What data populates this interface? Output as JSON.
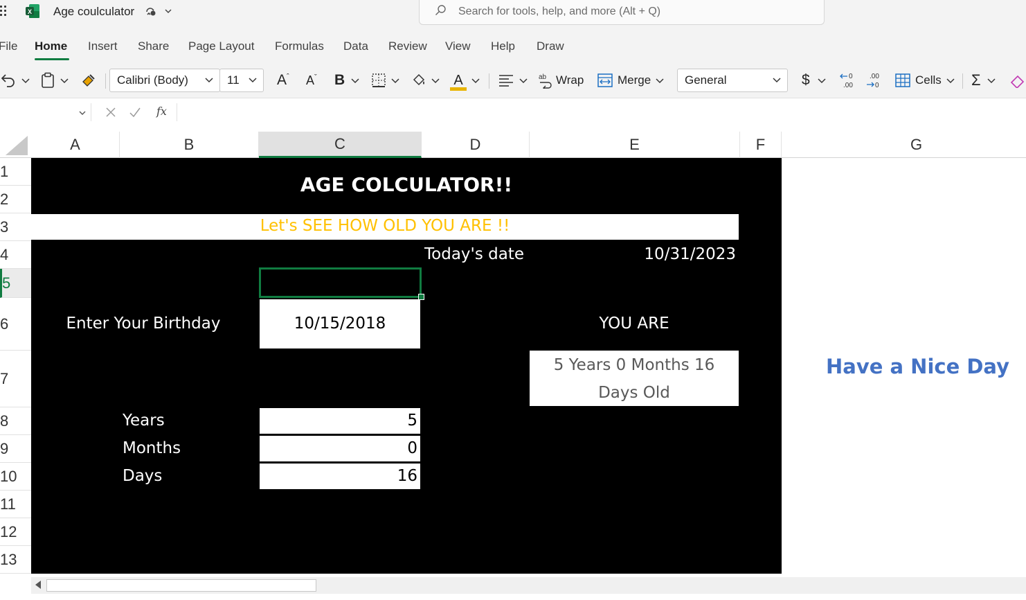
{
  "titlebar": {
    "doc_title": "Age coulculator",
    "search_placeholder": "Search for tools, help, and more (Alt + Q)"
  },
  "tabs": [
    {
      "label": "File"
    },
    {
      "label": "Home",
      "active": true
    },
    {
      "label": "Insert"
    },
    {
      "label": "Share"
    },
    {
      "label": "Page Layout"
    },
    {
      "label": "Formulas"
    },
    {
      "label": "Data"
    },
    {
      "label": "Review"
    },
    {
      "label": "View"
    },
    {
      "label": "Help"
    },
    {
      "label": "Draw"
    }
  ],
  "toolbar": {
    "font_name": "Calibri (Body)",
    "font_size": "11",
    "wrap_label": "Wrap",
    "merge_label": "Merge",
    "number_format": "General",
    "currency_symbol": "$",
    "cells_label": "Cells",
    "font_color": "#e8b400"
  },
  "formula_bar": {
    "fx_label": "fx"
  },
  "columns": [
    "A",
    "B",
    "C",
    "D",
    "E",
    "F",
    "G"
  ],
  "rows": [
    "1",
    "2",
    "3",
    "4",
    "5",
    "6",
    "7",
    "8",
    "9",
    "10",
    "11",
    "12",
    "13"
  ],
  "sheet": {
    "title": "AGE COLCULATOR!!",
    "subtitle": "Let's SEE HOW OLD YOU ARE !!",
    "todays_date_label": "Today's date",
    "todays_date_value": "10/31/2023",
    "birthday_label": "Enter Your Birthday",
    "birthday_value": "10/15/2018",
    "you_are_label": "YOU ARE",
    "result_line1": "5 Years 0 Months 16",
    "result_line2": "Days Old",
    "years_label": "Years",
    "years_value": "5",
    "months_label": "Months",
    "months_value": "0",
    "days_label": "Days",
    "days_value": "16",
    "side_message": "Have a Nice Day"
  },
  "colors": {
    "accent_green": "#107c41",
    "subtitle_orange": "#ffc000",
    "side_message_blue": "#4472c4",
    "result_gray": "#595959"
  }
}
